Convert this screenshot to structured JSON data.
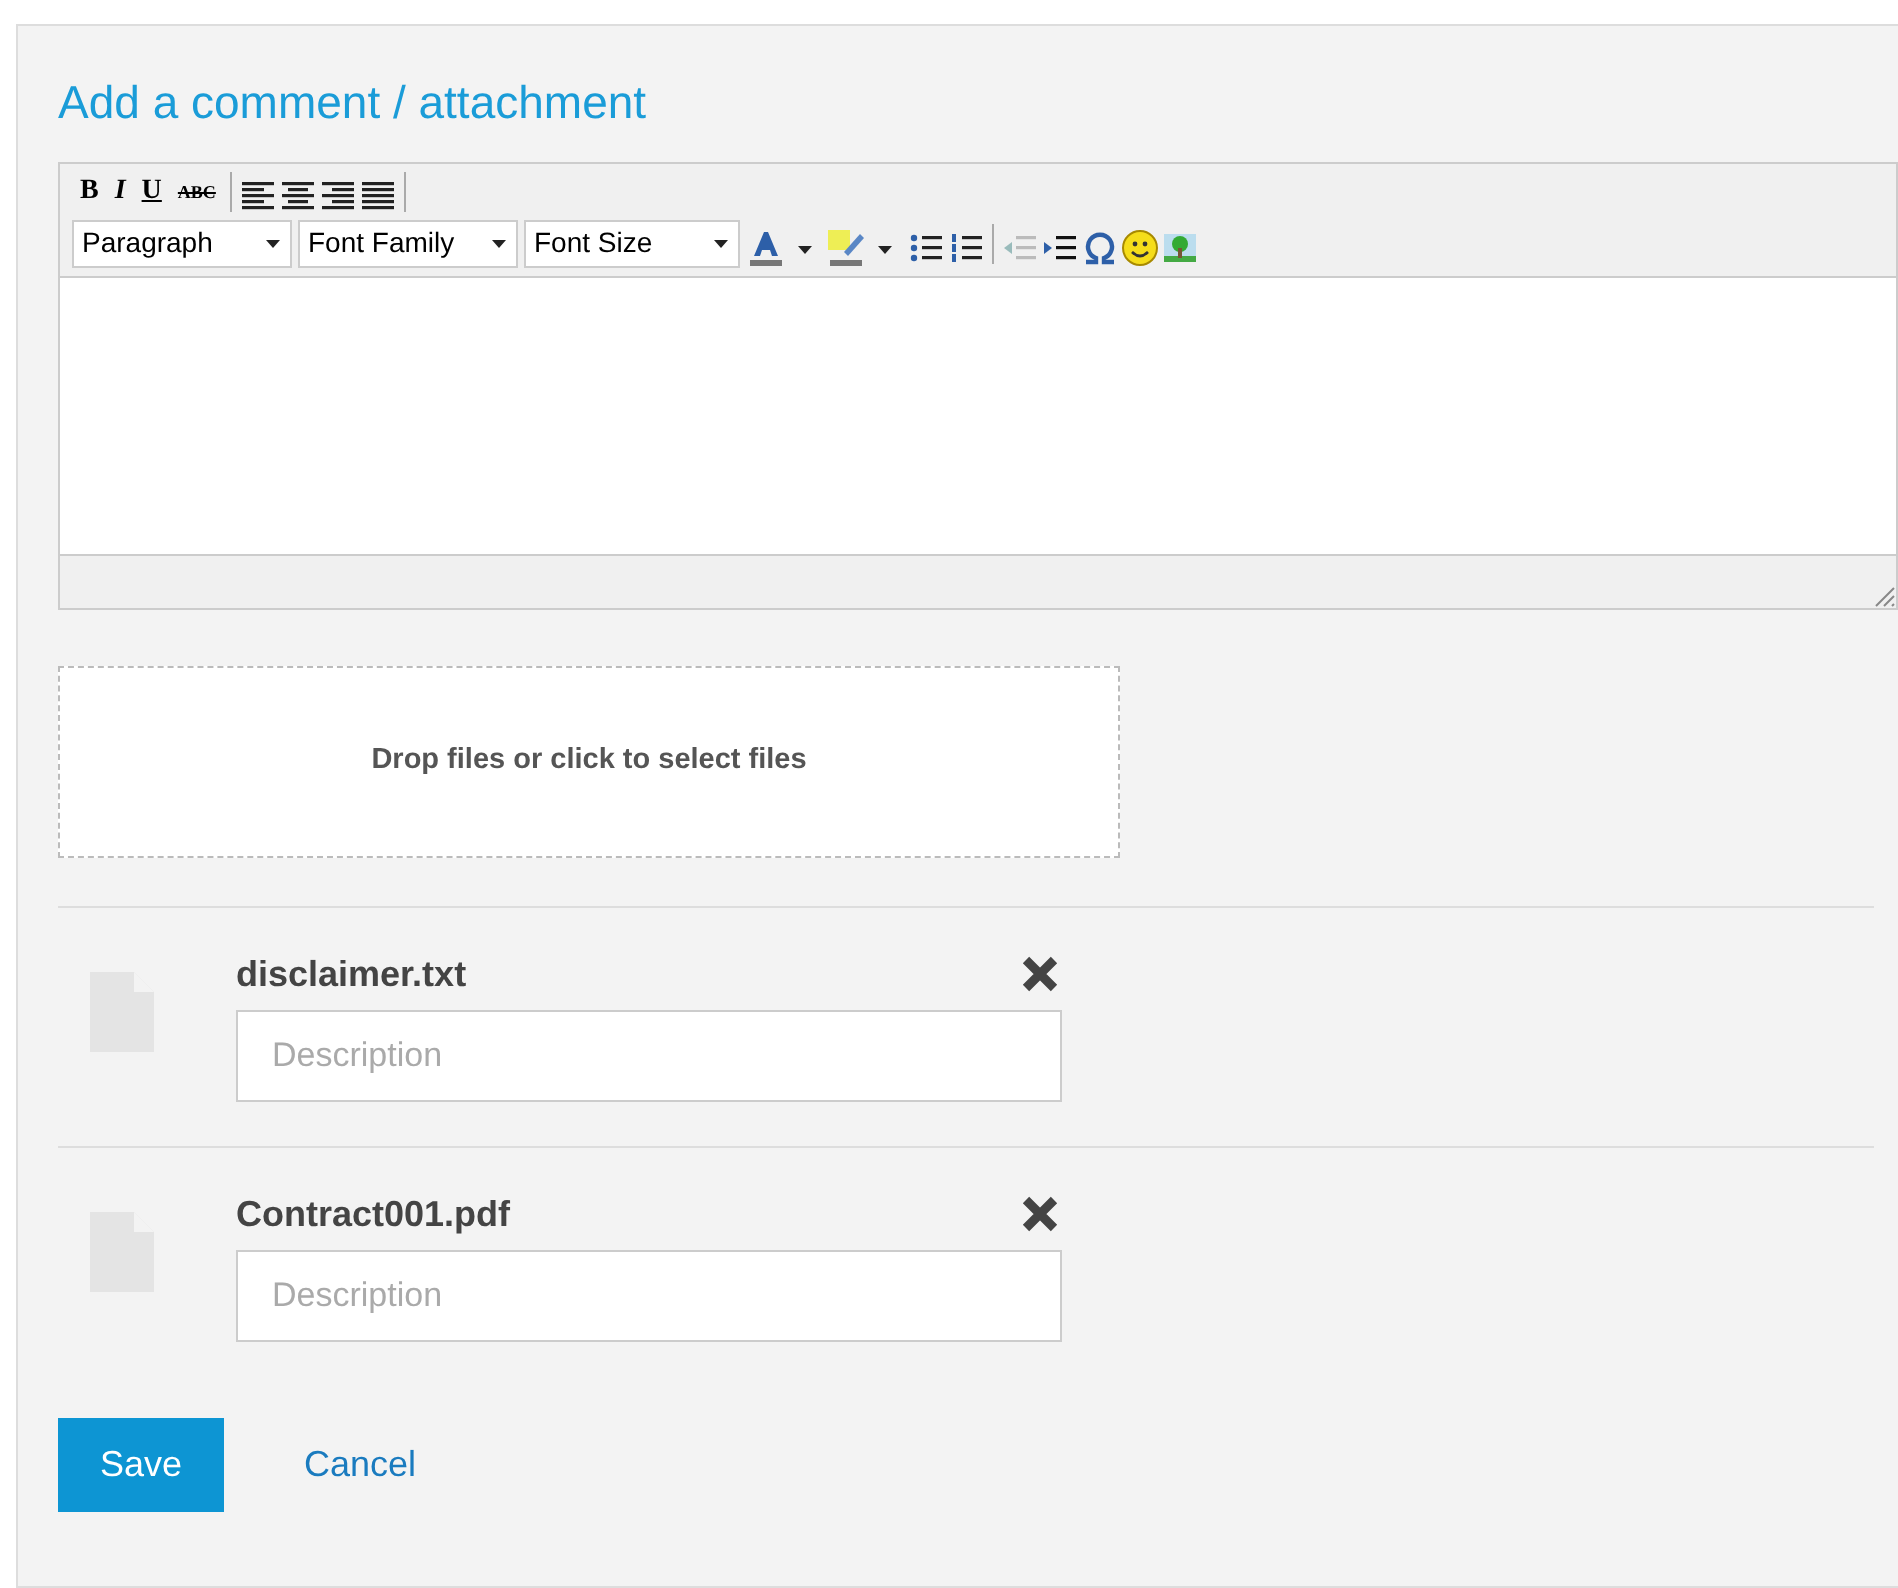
{
  "title": "Add a comment / attachment",
  "editor": {
    "format_buttons": [
      "B",
      "I",
      "U",
      "ABC"
    ],
    "selects": [
      "Paragraph",
      "Font Family",
      "Font Size"
    ]
  },
  "dropzone": {
    "text": "Drop files or click to select files"
  },
  "files": [
    {
      "name": "disclaimer.txt",
      "placeholder": "Description"
    },
    {
      "name": "Contract001.pdf",
      "placeholder": "Description"
    }
  ],
  "actions": {
    "save": "Save",
    "cancel": "Cancel"
  }
}
